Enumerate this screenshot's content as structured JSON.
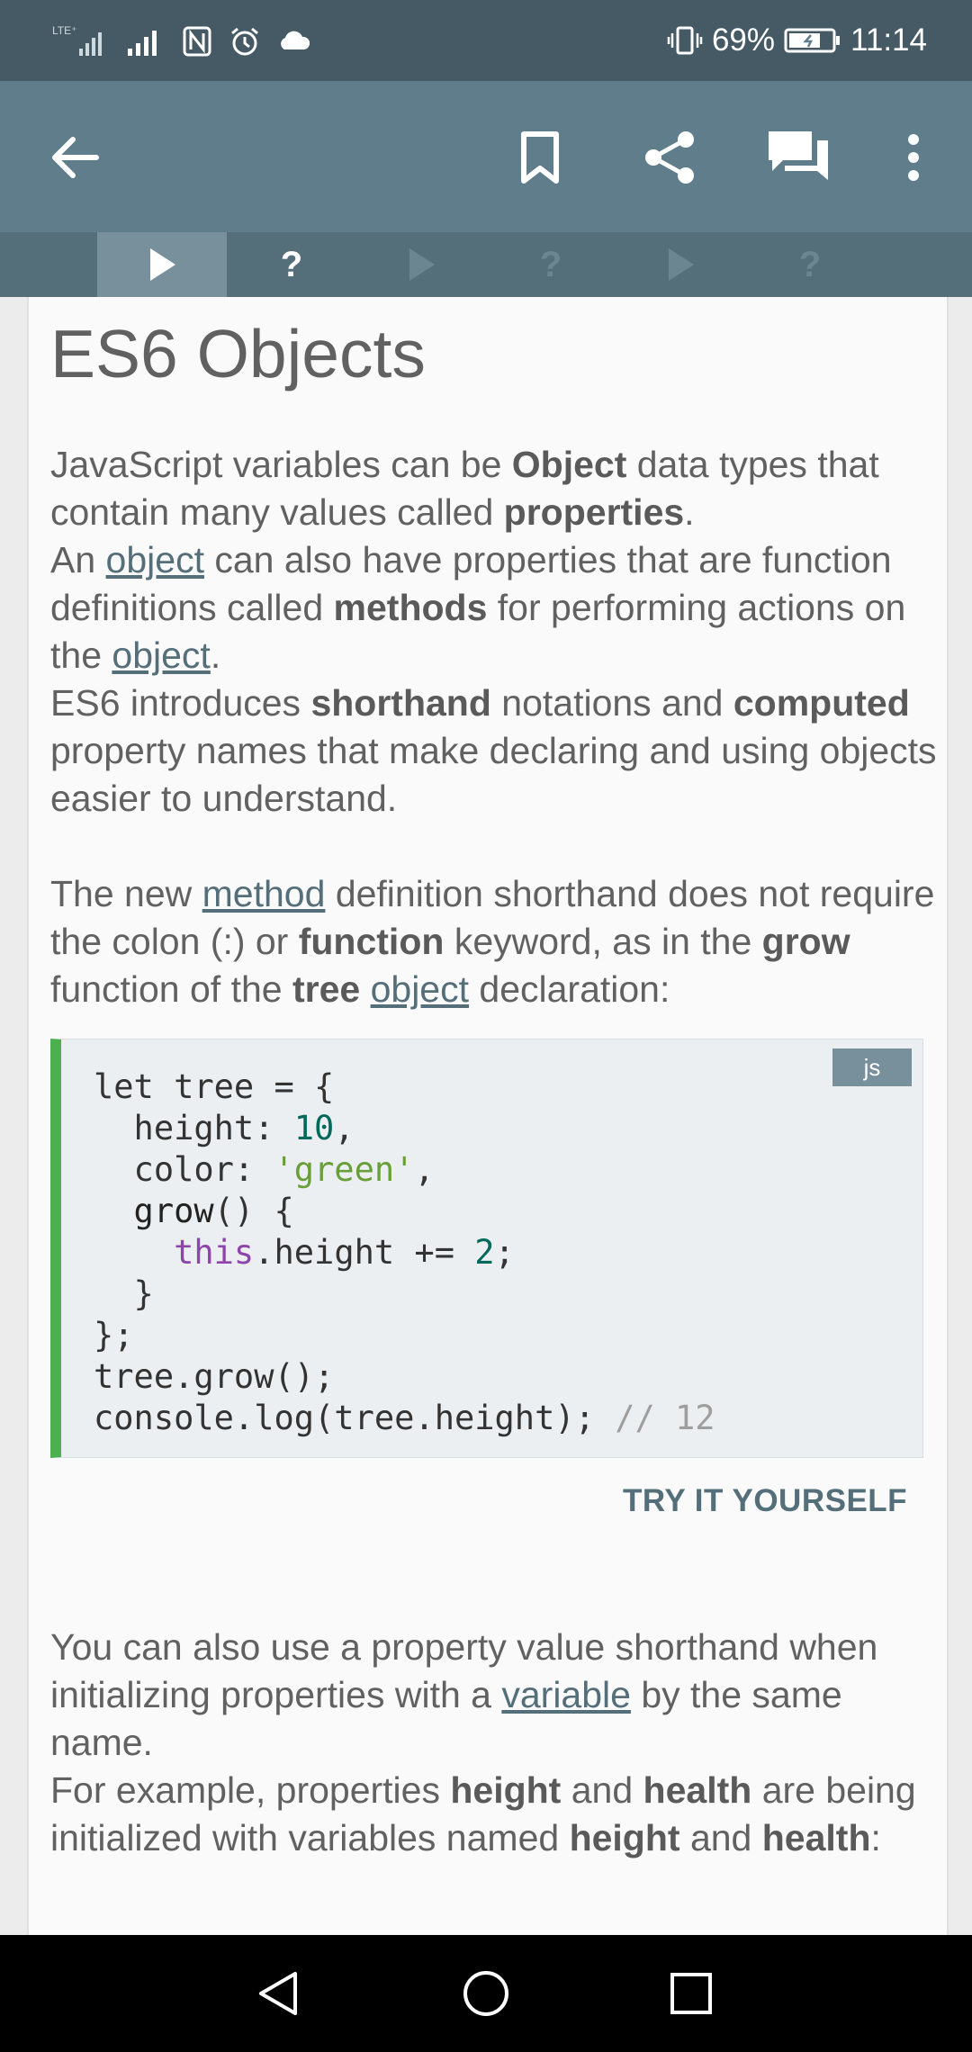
{
  "status_bar": {
    "battery_percent": "69%",
    "time": "11:14",
    "icons": [
      "lte-signal-icon",
      "signal-icon",
      "nfc-icon",
      "alarm-icon",
      "cloud-icon",
      "vibrate-icon",
      "battery-icon"
    ]
  },
  "toolbar": {
    "icons": [
      "back-arrow-icon",
      "bookmark-icon",
      "share-icon",
      "comments-icon",
      "more-vert-icon"
    ]
  },
  "progress_tabs": [
    {
      "type": "lesson",
      "glyph": "▶",
      "state": "active"
    },
    {
      "type": "quiz",
      "glyph": "?",
      "state": "unlocked"
    },
    {
      "type": "lesson",
      "glyph": "▶",
      "state": "locked"
    },
    {
      "type": "quiz",
      "glyph": "?",
      "state": "locked"
    },
    {
      "type": "lesson",
      "glyph": "▶",
      "state": "locked"
    },
    {
      "type": "quiz",
      "glyph": "?",
      "state": "locked"
    }
  ],
  "lesson": {
    "title": "ES6 Objects",
    "p1": {
      "t1": "JavaScript variables can be ",
      "b1": "Object",
      "t2": " data types that contain many values called ",
      "b2": "properties",
      "t3": ".",
      "t4": "An ",
      "l1": "object",
      "t5": " can also have properties that are function definitions called ",
      "b3": "methods",
      "t6": " for performing actions on the ",
      "l2": "object",
      "t7": ".",
      "t8": "ES6 introduces ",
      "b4": "shorthand",
      "t9": " notations and ",
      "b5": "computed",
      "t10": " property names that make declaring and using objects easier to understand."
    },
    "p2": {
      "t1": "The new ",
      "l1": "method",
      "t2": " definition shorthand does not require the colon (:) or ",
      "b1": "function",
      "t3": " keyword, as in the ",
      "b2": "grow",
      "t4": " function of the ",
      "b3": "tree",
      "t5": " ",
      "l2": "object",
      "t6": " declaration:"
    },
    "code": {
      "language_badge": "js",
      "line1": "let tree = {",
      "line2_key": "  height: ",
      "line2_val": "10",
      "line2_end": ",",
      "line3_key": "  color: ",
      "line3_val": "'green'",
      "line3_end": ",",
      "line4_fn": "  grow",
      "line4_end": "() {",
      "line5_indent": "    ",
      "line5_kw": "this",
      "line5_mid": ".height += ",
      "line5_val": "2",
      "line5_end": ";",
      "line6": "  }",
      "line7": "};",
      "line8": "tree.grow();",
      "line9_code": "console.log(tree.height); ",
      "line9_comment": "// 12"
    },
    "try_button": "TRY IT YOURSELF",
    "p3": {
      "t1": "You can also use a property value shorthand when initializing properties with a ",
      "l1": "variable",
      "t2": " by the same name.",
      "t3": "For example, properties ",
      "b1": "height",
      "t4": " and ",
      "b2": "health",
      "t5": " are being initialized with variables named ",
      "b3": "height",
      "t6": " and ",
      "b4": "health",
      "t7": ":"
    }
  },
  "nav_bar": {
    "icons": [
      "nav-back-icon",
      "nav-home-icon",
      "nav-recents-icon"
    ]
  }
}
